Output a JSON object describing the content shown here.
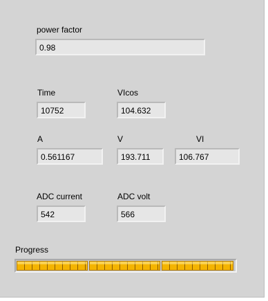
{
  "panel": {
    "power_factor": {
      "label": "power factor",
      "value": "0.98"
    },
    "time": {
      "label": "Time",
      "value": "10752"
    },
    "vicos": {
      "label": "VIcos",
      "value": "104.632"
    },
    "a": {
      "label": "A",
      "value": "0.561167"
    },
    "v": {
      "label": "V",
      "value": "193.711"
    },
    "vi": {
      "label": "VI",
      "value": "106.767"
    },
    "adc_current": {
      "label": "ADC current",
      "value": "542"
    },
    "adc_volt": {
      "label": "ADC volt",
      "value": "566"
    },
    "progress": {
      "label": "Progress",
      "fraction": 1.0
    }
  },
  "colors": {
    "panel_bg": "#d4d4d4",
    "field_bg": "#e6e6e6",
    "progress_fill": "#f4b400"
  }
}
